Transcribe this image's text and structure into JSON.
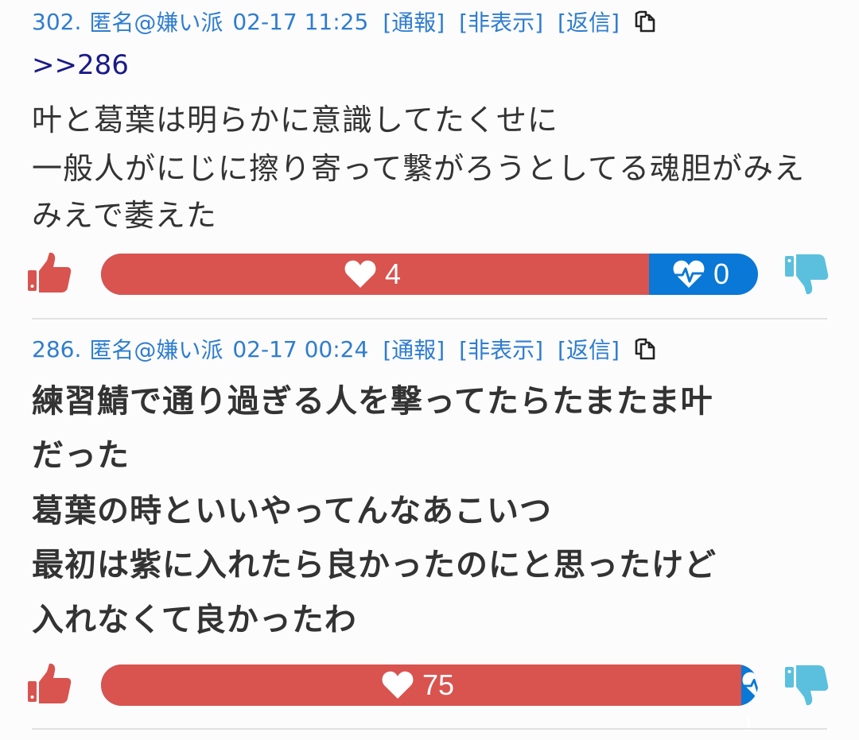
{
  "posts": [
    {
      "header": {
        "number": "302.",
        "name": "匿名@嫌い派",
        "datetime": "02-17 11:25",
        "report": "[通報]",
        "hide": "[非表示]",
        "reply": "[返信]"
      },
      "anchor": ">>286",
      "lines": [
        "叶と葛葉は明らかに意識してたくせに",
        "一般人がにじに擦り寄って繋がろうとしてる魂胆がみえ",
        "みえで萎えた"
      ],
      "likes": "4",
      "dislikes": "0",
      "like_ratio": 0.834
    },
    {
      "header": {
        "number": "286.",
        "name": "匿名@嫌い派",
        "datetime": "02-17 00:24",
        "report": "[通報]",
        "hide": "[非表示]",
        "reply": "[返信]"
      },
      "lines": [
        "練習鯖で通り過ぎる人を撃ってたらたまたま叶",
        "だった",
        "葛葉の時といいやってんなあこいつ",
        "最初は紫に入れたら良かったのにと思ったけど",
        "入れなくて良かったわ"
      ],
      "likes": "75",
      "dislikes": "1",
      "like_ratio": 0.974
    }
  ],
  "colors": {
    "link": "#2f7dd0",
    "anchor": "#1a1a8a",
    "like": "#d9534f",
    "dislike": "#0a78d6",
    "thumb_down": "#5bc0de"
  },
  "icons": {
    "thumb_up": "thumbs-up-icon",
    "thumb_down": "thumbs-down-icon",
    "heart": "heart-icon",
    "heartbeat": "heartbeat-icon",
    "copy": "copy-icon"
  }
}
